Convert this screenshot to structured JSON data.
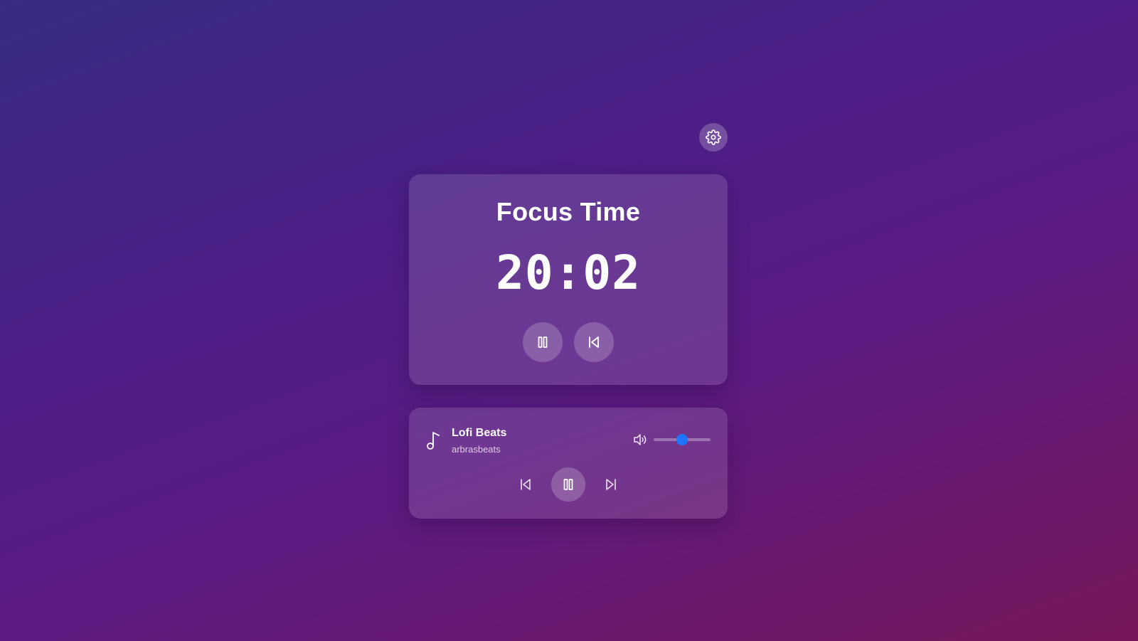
{
  "header": {
    "settings_icon": "gear-icon"
  },
  "timer": {
    "title": "Focus Time",
    "display": "20:02",
    "pause_icon": "pause-icon",
    "reset_icon": "skip-back-icon"
  },
  "music": {
    "track_title": "Lofi Beats",
    "track_artist": "arbrasbeats",
    "music_icon": "music-note-icon",
    "volume_icon": "volume-icon",
    "volume_level": 0.5,
    "prev_icon": "skip-back-icon",
    "pause_icon": "pause-icon",
    "next_icon": "skip-forward-icon"
  },
  "colors": {
    "accent": "#1f75fe",
    "background_start": "#372b80",
    "background_end": "#761659"
  }
}
